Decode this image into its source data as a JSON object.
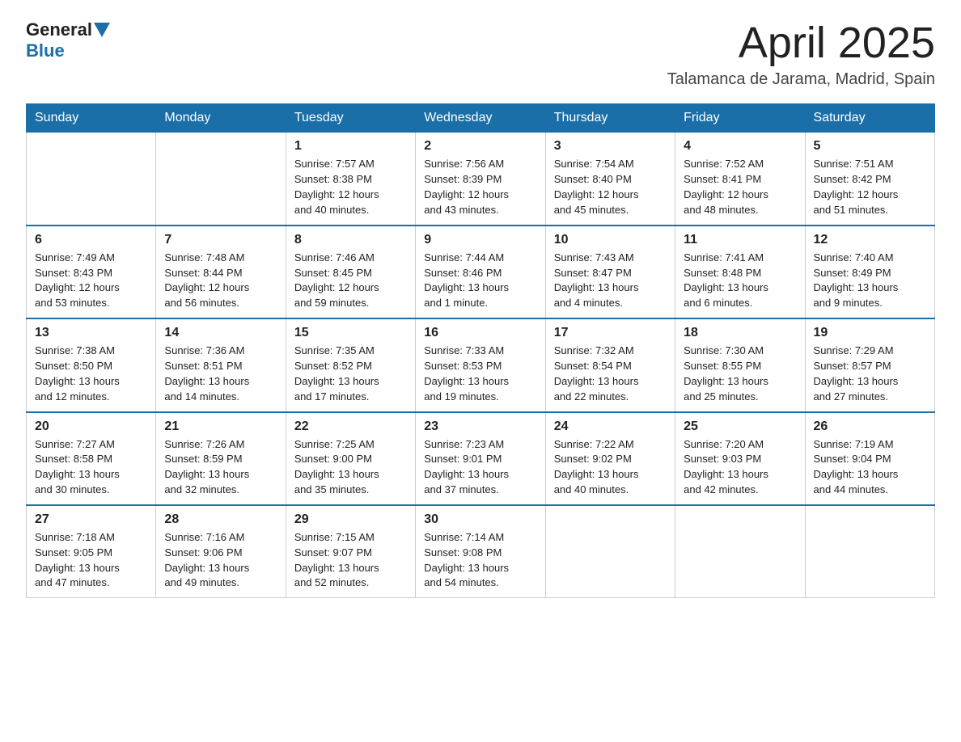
{
  "header": {
    "logo": {
      "text1": "General",
      "text2": "Blue"
    },
    "title": "April 2025",
    "location": "Talamanca de Jarama, Madrid, Spain"
  },
  "days_of_week": [
    "Sunday",
    "Monday",
    "Tuesday",
    "Wednesday",
    "Thursday",
    "Friday",
    "Saturday"
  ],
  "weeks": [
    [
      {
        "day": "",
        "info": ""
      },
      {
        "day": "",
        "info": ""
      },
      {
        "day": "1",
        "info": "Sunrise: 7:57 AM\nSunset: 8:38 PM\nDaylight: 12 hours\nand 40 minutes."
      },
      {
        "day": "2",
        "info": "Sunrise: 7:56 AM\nSunset: 8:39 PM\nDaylight: 12 hours\nand 43 minutes."
      },
      {
        "day": "3",
        "info": "Sunrise: 7:54 AM\nSunset: 8:40 PM\nDaylight: 12 hours\nand 45 minutes."
      },
      {
        "day": "4",
        "info": "Sunrise: 7:52 AM\nSunset: 8:41 PM\nDaylight: 12 hours\nand 48 minutes."
      },
      {
        "day": "5",
        "info": "Sunrise: 7:51 AM\nSunset: 8:42 PM\nDaylight: 12 hours\nand 51 minutes."
      }
    ],
    [
      {
        "day": "6",
        "info": "Sunrise: 7:49 AM\nSunset: 8:43 PM\nDaylight: 12 hours\nand 53 minutes."
      },
      {
        "day": "7",
        "info": "Sunrise: 7:48 AM\nSunset: 8:44 PM\nDaylight: 12 hours\nand 56 minutes."
      },
      {
        "day": "8",
        "info": "Sunrise: 7:46 AM\nSunset: 8:45 PM\nDaylight: 12 hours\nand 59 minutes."
      },
      {
        "day": "9",
        "info": "Sunrise: 7:44 AM\nSunset: 8:46 PM\nDaylight: 13 hours\nand 1 minute."
      },
      {
        "day": "10",
        "info": "Sunrise: 7:43 AM\nSunset: 8:47 PM\nDaylight: 13 hours\nand 4 minutes."
      },
      {
        "day": "11",
        "info": "Sunrise: 7:41 AM\nSunset: 8:48 PM\nDaylight: 13 hours\nand 6 minutes."
      },
      {
        "day": "12",
        "info": "Sunrise: 7:40 AM\nSunset: 8:49 PM\nDaylight: 13 hours\nand 9 minutes."
      }
    ],
    [
      {
        "day": "13",
        "info": "Sunrise: 7:38 AM\nSunset: 8:50 PM\nDaylight: 13 hours\nand 12 minutes."
      },
      {
        "day": "14",
        "info": "Sunrise: 7:36 AM\nSunset: 8:51 PM\nDaylight: 13 hours\nand 14 minutes."
      },
      {
        "day": "15",
        "info": "Sunrise: 7:35 AM\nSunset: 8:52 PM\nDaylight: 13 hours\nand 17 minutes."
      },
      {
        "day": "16",
        "info": "Sunrise: 7:33 AM\nSunset: 8:53 PM\nDaylight: 13 hours\nand 19 minutes."
      },
      {
        "day": "17",
        "info": "Sunrise: 7:32 AM\nSunset: 8:54 PM\nDaylight: 13 hours\nand 22 minutes."
      },
      {
        "day": "18",
        "info": "Sunrise: 7:30 AM\nSunset: 8:55 PM\nDaylight: 13 hours\nand 25 minutes."
      },
      {
        "day": "19",
        "info": "Sunrise: 7:29 AM\nSunset: 8:57 PM\nDaylight: 13 hours\nand 27 minutes."
      }
    ],
    [
      {
        "day": "20",
        "info": "Sunrise: 7:27 AM\nSunset: 8:58 PM\nDaylight: 13 hours\nand 30 minutes."
      },
      {
        "day": "21",
        "info": "Sunrise: 7:26 AM\nSunset: 8:59 PM\nDaylight: 13 hours\nand 32 minutes."
      },
      {
        "day": "22",
        "info": "Sunrise: 7:25 AM\nSunset: 9:00 PM\nDaylight: 13 hours\nand 35 minutes."
      },
      {
        "day": "23",
        "info": "Sunrise: 7:23 AM\nSunset: 9:01 PM\nDaylight: 13 hours\nand 37 minutes."
      },
      {
        "day": "24",
        "info": "Sunrise: 7:22 AM\nSunset: 9:02 PM\nDaylight: 13 hours\nand 40 minutes."
      },
      {
        "day": "25",
        "info": "Sunrise: 7:20 AM\nSunset: 9:03 PM\nDaylight: 13 hours\nand 42 minutes."
      },
      {
        "day": "26",
        "info": "Sunrise: 7:19 AM\nSunset: 9:04 PM\nDaylight: 13 hours\nand 44 minutes."
      }
    ],
    [
      {
        "day": "27",
        "info": "Sunrise: 7:18 AM\nSunset: 9:05 PM\nDaylight: 13 hours\nand 47 minutes."
      },
      {
        "day": "28",
        "info": "Sunrise: 7:16 AM\nSunset: 9:06 PM\nDaylight: 13 hours\nand 49 minutes."
      },
      {
        "day": "29",
        "info": "Sunrise: 7:15 AM\nSunset: 9:07 PM\nDaylight: 13 hours\nand 52 minutes."
      },
      {
        "day": "30",
        "info": "Sunrise: 7:14 AM\nSunset: 9:08 PM\nDaylight: 13 hours\nand 54 minutes."
      },
      {
        "day": "",
        "info": ""
      },
      {
        "day": "",
        "info": ""
      },
      {
        "day": "",
        "info": ""
      }
    ]
  ]
}
